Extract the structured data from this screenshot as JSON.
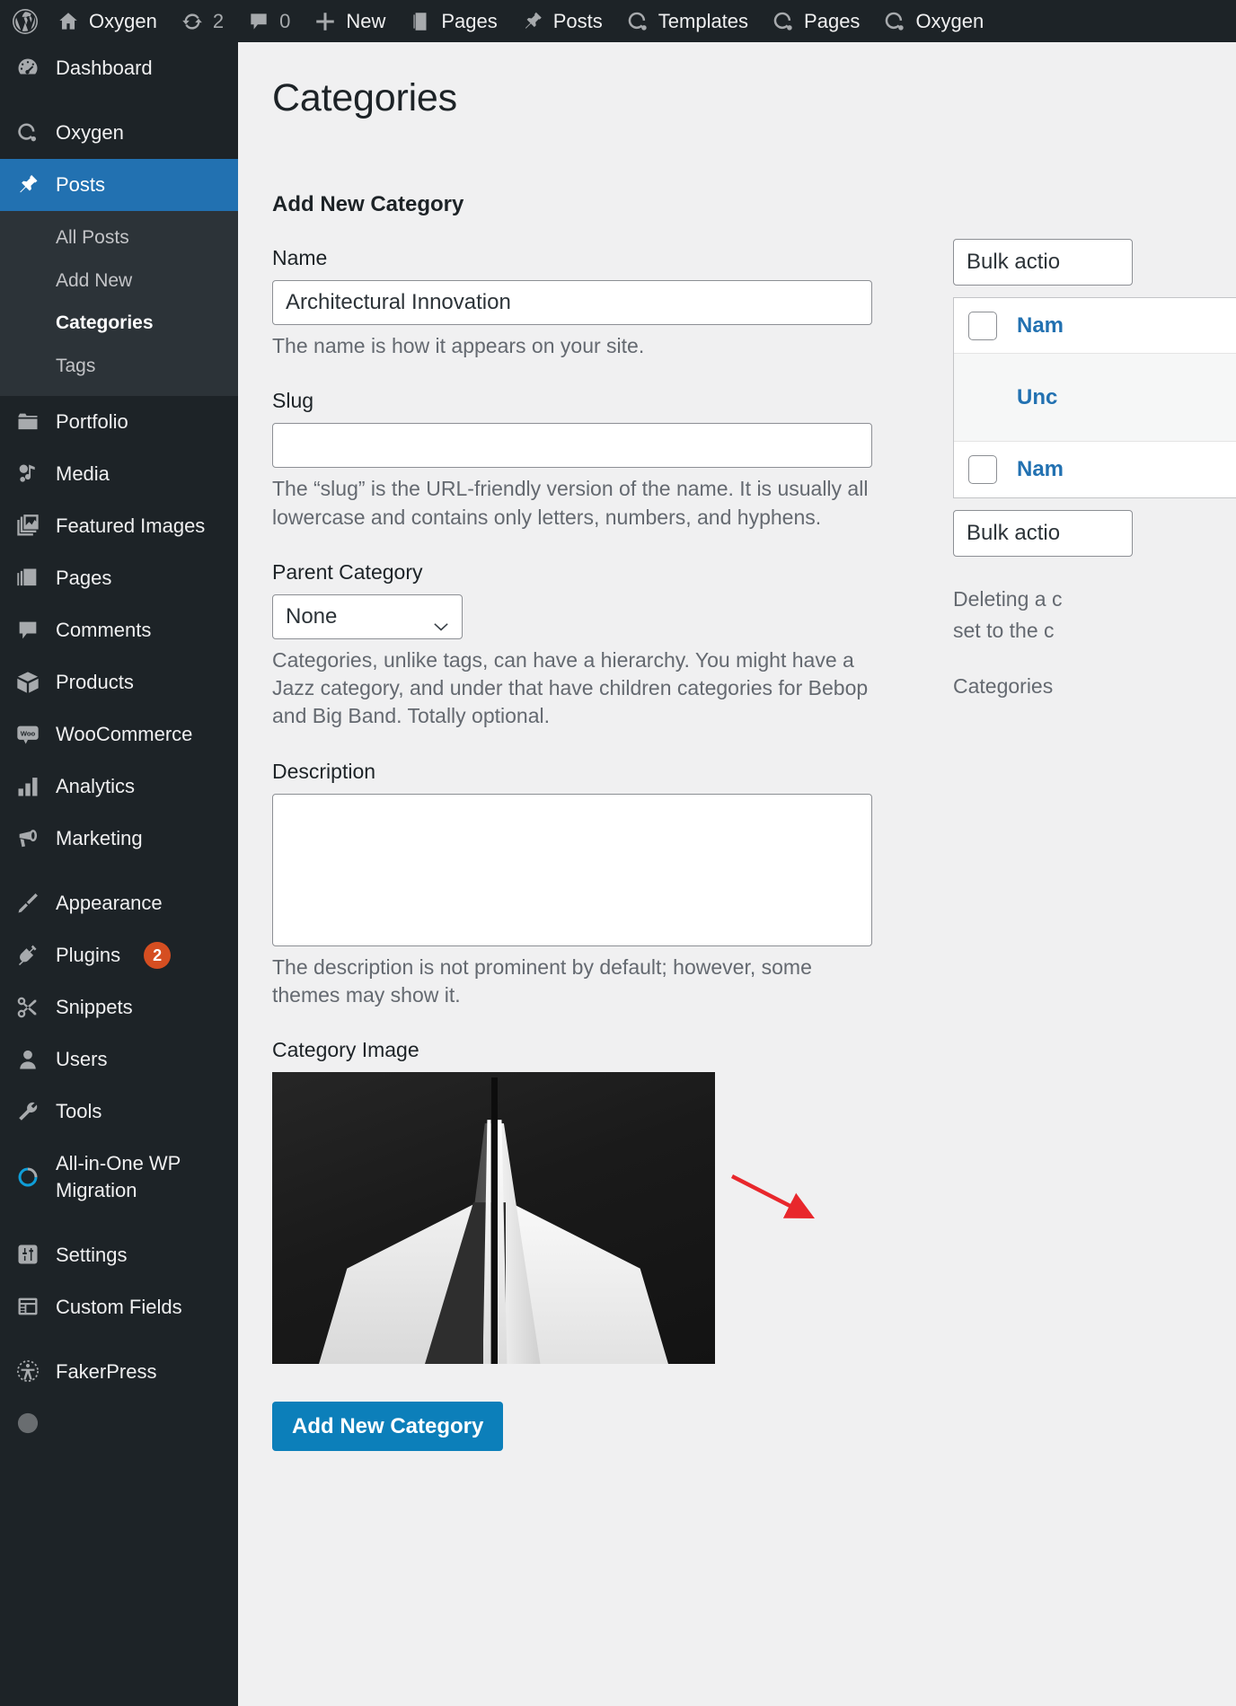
{
  "adminbar": {
    "logo_icon": "wordpress-logo-icon",
    "items": [
      {
        "icon": "home-icon",
        "label": "Oxygen",
        "name": "site-name"
      },
      {
        "icon": "updates-icon",
        "label": "2",
        "name": "updates"
      },
      {
        "icon": "comment-icon",
        "label": "0",
        "name": "comments"
      },
      {
        "icon": "plus-icon",
        "label": "New",
        "name": "new-content"
      },
      {
        "icon": "page-icon",
        "label": "Pages",
        "name": "pages"
      },
      {
        "icon": "pin-icon",
        "label": "Posts",
        "name": "posts"
      },
      {
        "icon": "oxygen-icon",
        "label": "Templates",
        "name": "templates"
      },
      {
        "icon": "oxygen-icon",
        "label": "Pages",
        "name": "oxygen-pages"
      },
      {
        "icon": "oxygen-icon",
        "label": "Oxygen",
        "name": "oxygen"
      }
    ]
  },
  "sidebar": {
    "items": [
      {
        "label": "Dashboard",
        "icon": "dashboard-icon",
        "name": "dashboard"
      },
      {
        "label": "Oxygen",
        "icon": "oxygen-icon",
        "name": "oxygen"
      },
      {
        "label": "Posts",
        "icon": "pin-icon",
        "name": "posts",
        "current": true
      },
      {
        "label": "Portfolio",
        "icon": "portfolio-icon",
        "name": "portfolio"
      },
      {
        "label": "Media",
        "icon": "media-icon",
        "name": "media"
      },
      {
        "label": "Featured Images",
        "icon": "images-icon",
        "name": "featured-images"
      },
      {
        "label": "Pages",
        "icon": "page-icon",
        "name": "pages"
      },
      {
        "label": "Comments",
        "icon": "comment-icon",
        "name": "comments"
      },
      {
        "label": "Products",
        "icon": "product-icon",
        "name": "products"
      },
      {
        "label": "WooCommerce",
        "icon": "woo-icon",
        "name": "woocommerce"
      },
      {
        "label": "Analytics",
        "icon": "analytics-icon",
        "name": "analytics"
      },
      {
        "label": "Marketing",
        "icon": "megaphone-icon",
        "name": "marketing"
      },
      {
        "label": "Appearance",
        "icon": "paintbrush-icon",
        "name": "appearance"
      },
      {
        "label": "Plugins",
        "icon": "plug-icon",
        "name": "plugins",
        "badge": "2"
      },
      {
        "label": "Snippets",
        "icon": "scissors-icon",
        "name": "snippets"
      },
      {
        "label": "Users",
        "icon": "user-icon",
        "name": "users"
      },
      {
        "label": "Tools",
        "icon": "wrench-icon",
        "name": "tools"
      },
      {
        "label": "All-in-One WP Migration",
        "icon": "migration-icon",
        "name": "all-in-one-wp-migration"
      },
      {
        "label": "Settings",
        "icon": "settings-icon",
        "name": "settings"
      },
      {
        "label": "Custom Fields",
        "icon": "custom-fields-icon",
        "name": "custom-fields"
      },
      {
        "label": "FakerPress",
        "icon": "fakerpress-icon",
        "name": "fakerpress"
      }
    ],
    "posts_submenu": [
      {
        "label": "All Posts",
        "name": "all-posts"
      },
      {
        "label": "Add New",
        "name": "add-new"
      },
      {
        "label": "Categories",
        "name": "categories",
        "current": true
      },
      {
        "label": "Tags",
        "name": "tags"
      }
    ]
  },
  "page": {
    "title": "Categories"
  },
  "form": {
    "heading": "Add New Category",
    "name_label": "Name",
    "name_value": "Architectural Innovation",
    "name_help": "The name is how it appears on your site.",
    "slug_label": "Slug",
    "slug_value": "",
    "slug_help": "The “slug” is the URL-friendly version of the name. It is usually all lowercase and contains only letters, numbers, and hyphens.",
    "parent_label": "Parent Category",
    "parent_value": "None",
    "parent_help": "Categories, unlike tags, can have a hierarchy. You might have a Jazz category, and under that have children categories for Bebop and Big Band. Totally optional.",
    "description_label": "Description",
    "description_value": "",
    "description_help": "The description is not prominent by default; however, some themes may show it.",
    "category_image_label": "Category Image",
    "submit_label": "Add New Category"
  },
  "list": {
    "bulk_actions_top": "Bulk actio",
    "bulk_actions_bottom": "Bulk actio",
    "header_name": "Nam",
    "row_uncategorized": "Unc",
    "footer_name": "Nam",
    "note_1_line_1": "Deleting a c",
    "note_1_line_2": "set to the c",
    "note_2": "Categories"
  },
  "colors": {
    "accent": "#2271b1",
    "button": "#0c7fba",
    "sidebar": "#1d2327",
    "link": "#2271b1",
    "badge": "#d54e21",
    "arrow": "#e8272c"
  }
}
